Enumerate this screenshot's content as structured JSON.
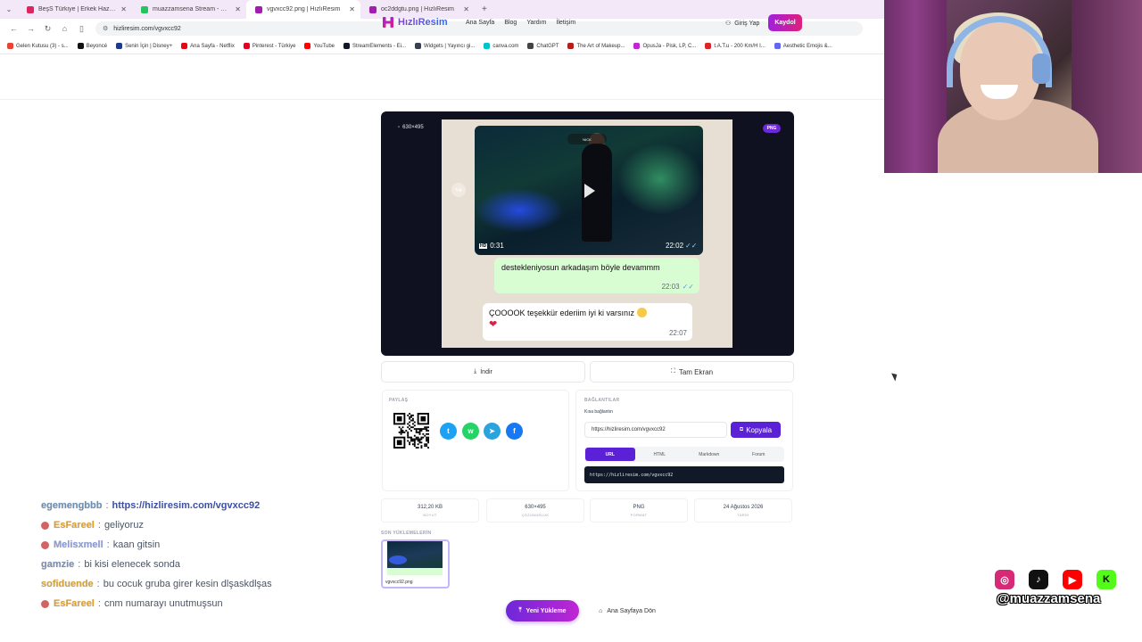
{
  "browser": {
    "tabs": [
      {
        "label": "BeşS Türkiye | Erkek Hazırlık Se",
        "fav_color": "#e0245e"
      },
      {
        "label": "muazzamsena Stream - Watch",
        "fav_color": "#22c55e"
      },
      {
        "label": "vgvxcc92.png | HızlıResim",
        "fav_color": "#a21caf",
        "active": true
      },
      {
        "label": "oc2ddgtu.png | HızlıResim",
        "fav_color": "#a21caf"
      }
    ],
    "url": "hizliresim.com/vgvxcc92",
    "bookmarks": [
      {
        "label": "Gelen Kutusu (3) - s...",
        "color": "#ea4335"
      },
      {
        "label": "Beyoncé",
        "color": "#111111"
      },
      {
        "label": "Senin İçin | Disney+",
        "color": "#1e3a8a"
      },
      {
        "label": "Ana Sayfa - Netflix",
        "color": "#e50914"
      },
      {
        "label": "Pinterest - Türkiye",
        "color": "#e60023"
      },
      {
        "label": "YouTube",
        "color": "#ff0000"
      },
      {
        "label": "StreamElements - Ei...",
        "color": "#111827"
      },
      {
        "label": "Widgets | Yayıncı gi...",
        "color": "#374151"
      },
      {
        "label": "canva.com",
        "color": "#00c4cc"
      },
      {
        "label": "ChatGPT",
        "color": "#444444"
      },
      {
        "label": "The Art of Makeup...",
        "color": "#b91c1c"
      },
      {
        "label": "OpusJa - Pisk, LP, C...",
        "color": "#c026d3"
      },
      {
        "label": "t.A.T.u - 200 Km/H I...",
        "color": "#dc2626"
      },
      {
        "label": "Aesthetic Emojis &...",
        "color": "#6366f1"
      }
    ]
  },
  "site": {
    "logo": "HızlıResim",
    "nav": [
      "Ana Sayfa",
      "Blog",
      "Yardım",
      "İletişim"
    ],
    "login": "Giriş Yap",
    "signup": "Kaydol"
  },
  "viewer": {
    "dimensions": "630×495",
    "format_badge": "PNG",
    "video_duration": "0:31",
    "video_time": "22:02",
    "video_watermark": "NICK",
    "message_out": {
      "text": "destekleniyosun arkadaşım böyle devammm",
      "time": "22:03"
    },
    "message_in": {
      "text": "ÇOOOOK teşekkür ederiim iyi ki varsınız",
      "time": "22:07"
    }
  },
  "actions": {
    "download": "İndir",
    "fullscreen": "Tam Ekran"
  },
  "share": {
    "title": "PAYLAŞ",
    "networks": [
      {
        "name": "twitter",
        "glyph": "t",
        "color": "#1da1f2"
      },
      {
        "name": "whatsapp",
        "glyph": "w",
        "color": "#25d366"
      },
      {
        "name": "telegram",
        "glyph": "➤",
        "color": "#2aa3de"
      },
      {
        "name": "facebook",
        "glyph": "f",
        "color": "#1877f2"
      }
    ]
  },
  "links": {
    "title": "BAĞLANTILAR",
    "short_label": "Kısa bağlantın",
    "short_url": "https://hizliresim.com/vgvxcc92",
    "copy": "Kopyala",
    "tabs": [
      "URL",
      "HTML",
      "Markdown",
      "Forum"
    ],
    "active_tab": "URL",
    "code": "https://hizliresim.com/vgvxcc92"
  },
  "stats": [
    {
      "value": "312,20 KB",
      "label": "BOYUT"
    },
    {
      "value": "630×495",
      "label": "ÇÖZÜNÜRLÜK"
    },
    {
      "value": "PNG",
      "label": "FORMAT"
    },
    {
      "value": "24 Ağustos 2026",
      "label": "TARİH"
    }
  ],
  "recent": {
    "title": "SON YÜKLEMELERİN",
    "items": [
      {
        "name": "vgvxcc92.png"
      }
    ]
  },
  "bottom": {
    "new_upload": "Yeni Yükleme",
    "home": "Ana Sayfaya Dön"
  },
  "chat": [
    {
      "user": "egemengbbb",
      "user_color": "#6b8fb5",
      "badge": false,
      "text": "https://hizliresim.com/vgvxcc92",
      "is_link": true
    },
    {
      "user": "EsFareel",
      "user_color": "#e0a030",
      "badge": true,
      "text": "geliyoruz",
      "is_link": false
    },
    {
      "user": "Melisxmell",
      "user_color": "#8a9bd8",
      "badge": true,
      "text": "kaan gitsin",
      "is_link": false
    },
    {
      "user": "gamzie",
      "user_color": "#7c8fb0",
      "badge": false,
      "text": "bi kisi elenecek sonda",
      "is_link": false
    },
    {
      "user": "sofiduende",
      "user_color": "#d4a23a",
      "badge": false,
      "text": "bu cocuk gruba girer kesin dlşaskdlşas",
      "is_link": false
    },
    {
      "user": "EsFareel",
      "user_color": "#e0a030",
      "badge": true,
      "text": "cnm numarayı unutmuşsun",
      "is_link": false
    }
  ],
  "stream": {
    "handle": "@muazzamsena",
    "socials": [
      {
        "name": "instagram",
        "glyph": "◎",
        "color": "#d62976"
      },
      {
        "name": "tiktok",
        "glyph": "♪",
        "color": "#111111"
      },
      {
        "name": "youtube",
        "glyph": "▶",
        "color": "#ff0000"
      },
      {
        "name": "kick",
        "glyph": "K",
        "color": "#53fc18"
      }
    ]
  }
}
